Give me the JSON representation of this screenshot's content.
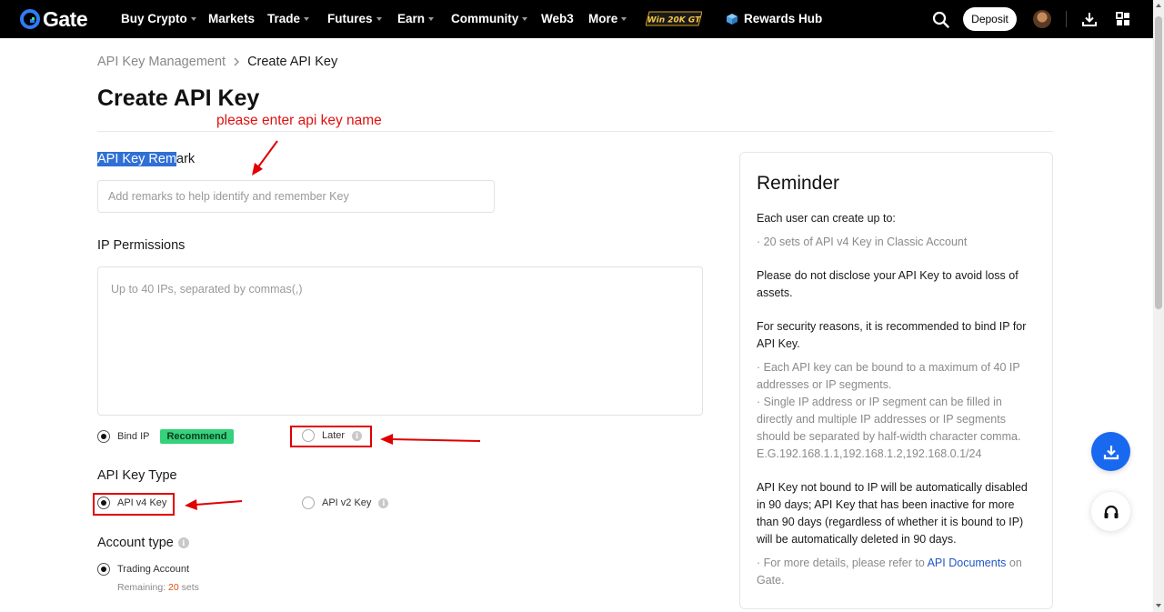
{
  "nav": {
    "logo_text": "Gate",
    "items": [
      {
        "label": "Buy Crypto",
        "dropdown": true
      },
      {
        "label": "Markets",
        "dropdown": false
      },
      {
        "label": "Trade",
        "dropdown": true
      },
      {
        "label": "Futures",
        "dropdown": true
      },
      {
        "label": "Earn",
        "dropdown": true
      },
      {
        "label": "Community",
        "dropdown": true
      },
      {
        "label": "Web3",
        "dropdown": false
      },
      {
        "label": "More",
        "dropdown": true
      }
    ],
    "promo_text": "Win 20K GT",
    "rewards_label": "Rewards Hub",
    "deposit_label": "Deposit",
    "icons": [
      "search-icon",
      "avatar",
      "download-icon",
      "grid-icon"
    ]
  },
  "breadcrumb": {
    "parent": "API Key Management",
    "separator": ">",
    "current": "Create API Key"
  },
  "page": {
    "title": "Create API Key"
  },
  "annotation": {
    "text": "please enter api key name",
    "color": "#e01010"
  },
  "form": {
    "remark": {
      "label_highlighted": "API Key Rem",
      "label_rest": "ark",
      "placeholder": "Add remarks to help identify and remember Key",
      "value": ""
    },
    "ip_permissions": {
      "label": "IP Permissions",
      "placeholder": "Up to 40 IPs, separated by commas(,)",
      "options": [
        {
          "label": "Bind IP",
          "selected": true,
          "tag": "Recommend"
        },
        {
          "label": "Later",
          "selected": false,
          "info": true
        }
      ]
    },
    "key_type": {
      "label": "API Key Type",
      "options": [
        {
          "label": "API v4 Key",
          "selected": true
        },
        {
          "label": "API v2 Key",
          "selected": false,
          "info": true
        }
      ]
    },
    "account_type": {
      "label": "Account type",
      "options": [
        {
          "label": "Trading Account",
          "selected": true
        }
      ],
      "remaining_prefix": "Remaining: ",
      "remaining_count": "20",
      "remaining_suffix": " sets"
    }
  },
  "reminder": {
    "title": "Reminder",
    "p1": "Each user can create up to:",
    "p1_sub": "· 20 sets of API v4 Key in Classic Account",
    "p2": "Please do not disclose your API Key to avoid loss of assets.",
    "p3": "For security reasons, it is recommended to bind IP for API Key.",
    "p3_sub1": "· Each API key can be bound to a maximum of 40 IP addresses or IP segments.",
    "p3_sub2": "· Single IP address or IP segment can be filled in directly and multiple IP addresses or IP segments should be separated by half-width character comma. E.G.192.168.1.1,192.168.1.2,192.168.0.1/24",
    "p4": "API Key not bound to IP will be automatically disabled in 90 days; API Key that has been inactive for more than 90 days (regardless of whether it is bound to IP) will be automatically deleted in 90 days.",
    "p5_prefix": "· For more details, please refer to ",
    "p5_link": "API Documents",
    "p5_suffix": " on Gate."
  },
  "colors": {
    "nav_bg": "#000000",
    "accent_blue": "#1968f0",
    "recommend_tag": "#35d17b",
    "annotation_red": "#e00000",
    "highlight": "#2f6fd6"
  }
}
